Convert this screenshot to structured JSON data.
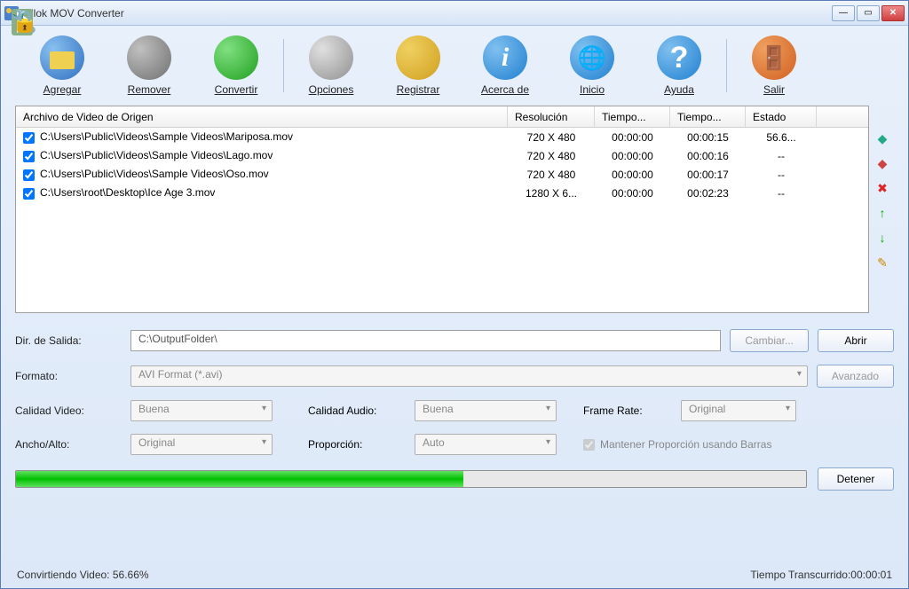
{
  "window": {
    "title": "Allok MOV Converter"
  },
  "toolbar": {
    "agregar": "Agregar",
    "remover": "Remover",
    "convertir": "Convertir",
    "opciones": "Opciones",
    "registrar": "Registrar",
    "acerca": "Acerca de",
    "inicio": "Inicio",
    "ayuda": "Ayuda",
    "salir": "Salir"
  },
  "list": {
    "headers": {
      "file": "Archivo de Video de Origen",
      "res": "Resolución",
      "t1": "Tiempo...",
      "t2": "Tiempo...",
      "estado": "Estado"
    },
    "rows": [
      {
        "file": "C:\\Users\\Public\\Videos\\Sample Videos\\Mariposa.mov",
        "res": "720 X 480",
        "t1": "00:00:00",
        "t2": "00:00:15",
        "estado": "56.6..."
      },
      {
        "file": "C:\\Users\\Public\\Videos\\Sample Videos\\Lago.mov",
        "res": "720 X 480",
        "t1": "00:00:00",
        "t2": "00:00:16",
        "estado": "--"
      },
      {
        "file": "C:\\Users\\Public\\Videos\\Sample Videos\\Oso.mov",
        "res": "720 X 480",
        "t1": "00:00:00",
        "t2": "00:00:17",
        "estado": "--"
      },
      {
        "file": "C:\\Users\\root\\Desktop\\Ice Age 3.mov",
        "res": "1280 X 6...",
        "t1": "00:00:00",
        "t2": "00:02:23",
        "estado": "--"
      }
    ]
  },
  "settings": {
    "dir_label": "Dir. de Salida:",
    "dir_value": "C:\\OutputFolder\\",
    "cambiar": "Cambiar...",
    "abrir": "Abrir",
    "formato_label": "Formato:",
    "formato_value": "AVI Format (*.avi)",
    "avanzado": "Avanzado",
    "calidad_video_label": "Calidad Video:",
    "calidad_video_value": "Buena",
    "calidad_audio_label": "Calidad Audio:",
    "calidad_audio_value": "Buena",
    "framerate_label": "Frame Rate:",
    "framerate_value": "Original",
    "ancho_label": "Ancho/Alto:",
    "ancho_value": "Original",
    "proporcion_label": "Proporción:",
    "proporcion_value": "Auto",
    "mantener_label": "Mantener Proporción usando Barras",
    "detener": "Detener"
  },
  "status": {
    "converting": "Convirtiendo Video: 56.66%",
    "elapsed": "Tiempo Transcurrido:00:00:01"
  },
  "progress_pct": 56.66
}
